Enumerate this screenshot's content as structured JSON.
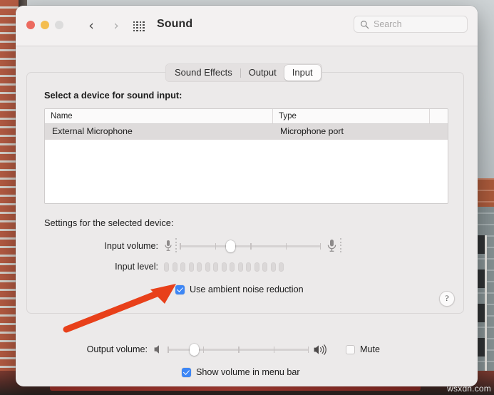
{
  "window": {
    "title": "Sound",
    "traffic_lights": [
      "close",
      "minimize",
      "zoom"
    ],
    "back_glyph": "‹",
    "forward_glyph": "›",
    "grid_icon": "grid-icon"
  },
  "search": {
    "placeholder": "Search",
    "value": "",
    "icon": "search-icon"
  },
  "tabs": [
    {
      "label": "Sound Effects",
      "selected": false
    },
    {
      "label": "Output",
      "selected": false
    },
    {
      "label": "Input",
      "selected": true
    }
  ],
  "panel": {
    "select_device_label": "Select a device for sound input:",
    "settings_label": "Settings for the selected device:",
    "help_label": "?",
    "table": {
      "columns": [
        "Name",
        "Type",
        ""
      ],
      "rows": [
        {
          "name": "External Microphone",
          "type": "Microphone port",
          "selected": true
        }
      ]
    },
    "input_volume": {
      "label": "Input volume:",
      "value_percent": 35,
      "left_icon": "microphone-icon",
      "right_icon": "microphone-icon",
      "ticks": 3
    },
    "input_level": {
      "label": "Input level:",
      "segments_total": 15,
      "segments_lit": 0
    },
    "noise_reduction": {
      "label": "Use ambient noise reduction",
      "checked": true
    }
  },
  "bottom": {
    "output_volume": {
      "label": "Output volume:",
      "value_percent": 17,
      "left_icon": "speaker-muted-icon",
      "right_icon": "speaker-loud-icon",
      "ticks": 3
    },
    "mute": {
      "label": "Mute",
      "checked": false
    },
    "show_volume": {
      "label": "Show volume in menu bar",
      "checked": true
    }
  },
  "annotation": {
    "arrow_color": "#e8401a",
    "points_to": "Use ambient noise reduction"
  },
  "watermark": {
    "text": "wsxdn.com"
  },
  "colors": {
    "accent": "#3d86f5",
    "window_bg": "#eceaea",
    "titlebar_bg": "#f3f1f1",
    "selected_row": "#dedbdb"
  }
}
